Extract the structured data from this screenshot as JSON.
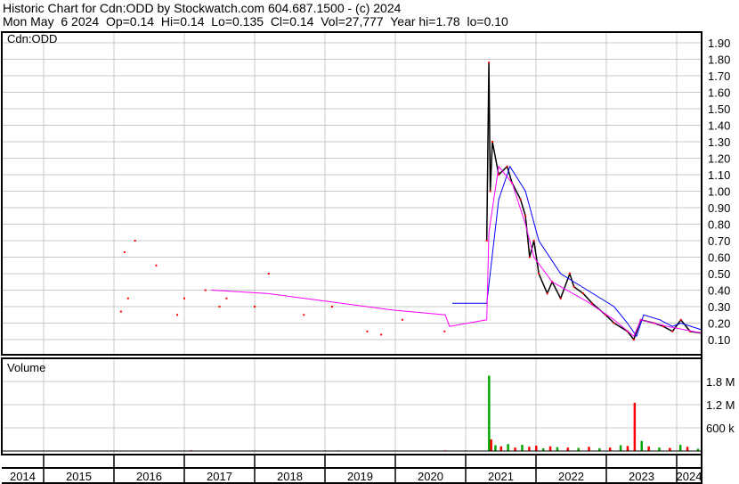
{
  "header": {
    "title": "Historic Chart for Cdn:ODD by Stockwatch.com 604.687.1500 - (c) 2024",
    "quote": "Mon May  6 2024  Op=0.14  Hi=0.14  Lo=0.135  Cl=0.14  Vol=27,777  Year hi=1.78  lo=0.10"
  },
  "colors": {
    "price": "#000000",
    "ma_short": "#ff00ff",
    "ma_long": "#0000ff",
    "dots": "#ff0000",
    "vol_up": "#00aa00",
    "vol_down": "#ff0000",
    "grid": "#c8c8c8"
  },
  "chart_data": [
    {
      "type": "line",
      "title": "Cdn:ODD",
      "ylim": [
        0,
        1.95
      ],
      "yticks": [
        "1.90",
        "1.80",
        "1.70",
        "1.60",
        "1.50",
        "1.40",
        "1.30",
        "1.20",
        "1.10",
        "1.00",
        "0.90",
        "0.80",
        "0.70",
        "0.60",
        "0.50",
        "0.40",
        "0.30",
        "0.20",
        "0.10"
      ],
      "xlim": [
        2014,
        2024.42
      ],
      "xticks": [
        "2014",
        "2015",
        "2016",
        "2017",
        "2018",
        "2019",
        "2020",
        "2021",
        "2022",
        "2023",
        "2024"
      ],
      "series": [
        {
          "name": "price",
          "x": [
            2021.3,
            2021.33,
            2021.35,
            2021.38,
            2021.47,
            2021.59,
            2021.66,
            2021.78,
            2021.85,
            2021.91,
            2021.97,
            2022.04,
            2022.16,
            2022.23,
            2022.35,
            2022.48,
            2022.54,
            2022.67,
            2022.8,
            2022.99,
            2023.11,
            2023.3,
            2023.39,
            2023.49,
            2023.68,
            2023.81,
            2023.94,
            2024.06,
            2024.19,
            2024.35
          ],
          "y": [
            0.7,
            1.78,
            1.0,
            1.3,
            1.1,
            1.15,
            1.05,
            0.95,
            0.85,
            0.6,
            0.7,
            0.5,
            0.38,
            0.45,
            0.35,
            0.5,
            0.42,
            0.38,
            0.32,
            0.25,
            0.2,
            0.15,
            0.1,
            0.22,
            0.2,
            0.18,
            0.15,
            0.22,
            0.15,
            0.14
          ]
        },
        {
          "name": "ma_long",
          "x": [
            2020.81,
            2021.3,
            2021.47,
            2021.63,
            2021.85,
            2022.04,
            2022.35,
            2022.73,
            2023.11,
            2023.3,
            2023.43,
            2023.53,
            2023.76,
            2023.94,
            2024.06,
            2024.35
          ],
          "y": [
            0.32,
            0.32,
            0.95,
            1.15,
            1.0,
            0.7,
            0.5,
            0.4,
            0.3,
            0.2,
            0.12,
            0.25,
            0.22,
            0.18,
            0.2,
            0.16
          ]
        },
        {
          "name": "ma_short",
          "x": [
            2017.38,
            2018.18,
            2019.95,
            2020.71,
            2020.77,
            2021.3,
            2021.33,
            2021.47,
            2021.66,
            2021.85,
            2021.97,
            2022.23,
            2022.73,
            2023.11,
            2023.39,
            2023.49,
            2023.87,
            2024.35
          ],
          "y": [
            0.4,
            0.38,
            0.28,
            0.25,
            0.18,
            0.22,
            0.75,
            1.15,
            1.05,
            0.8,
            0.6,
            0.45,
            0.33,
            0.22,
            0.12,
            0.22,
            0.18,
            0.14
          ]
        },
        {
          "name": "trades",
          "x": [
            2016.1,
            2016.15,
            2016.2,
            2016.3,
            2016.6,
            2016.9,
            2017.0,
            2017.3,
            2017.5,
            2017.6,
            2018.0,
            2018.2,
            2018.7,
            2019.1,
            2019.6,
            2019.8,
            2020.1,
            2020.7
          ],
          "y": [
            0.27,
            0.63,
            0.35,
            0.7,
            0.55,
            0.25,
            0.35,
            0.4,
            0.3,
            0.35,
            0.3,
            0.5,
            0.25,
            0.3,
            0.15,
            0.13,
            0.22,
            0.15
          ]
        }
      ]
    },
    {
      "type": "bar",
      "title": "Volume",
      "ylim": [
        0,
        2000000
      ],
      "ytick_labels": [
        "1.8 M",
        "1.2 M",
        "600 k"
      ],
      "yticks": [
        1800000,
        1200000,
        600000
      ],
      "x": [
        2016.3,
        2017.1,
        2018.0,
        2019.2,
        2020.2,
        2020.7,
        2021.33,
        2021.36,
        2021.42,
        2021.5,
        2021.6,
        2021.7,
        2021.8,
        2021.9,
        2022.0,
        2022.1,
        2022.2,
        2022.3,
        2022.45,
        2022.6,
        2022.75,
        2022.9,
        2023.05,
        2023.2,
        2023.3,
        2023.4,
        2023.5,
        2023.6,
        2023.75,
        2023.9,
        2024.05,
        2024.15,
        2024.3
      ],
      "values": [
        15000,
        20000,
        12000,
        15000,
        10000,
        18000,
        1950000,
        300000,
        150000,
        120000,
        180000,
        90000,
        160000,
        110000,
        140000,
        70000,
        120000,
        100000,
        90000,
        80000,
        110000,
        70000,
        90000,
        150000,
        130000,
        1250000,
        260000,
        120000,
        90000,
        80000,
        160000,
        110000,
        60000
      ],
      "up": [
        true,
        false,
        true,
        false,
        true,
        false,
        true,
        false,
        true,
        false,
        true,
        false,
        true,
        false,
        false,
        true,
        false,
        true,
        false,
        true,
        false,
        true,
        false,
        true,
        false,
        false,
        true,
        false,
        true,
        false,
        true,
        false,
        true
      ]
    }
  ]
}
